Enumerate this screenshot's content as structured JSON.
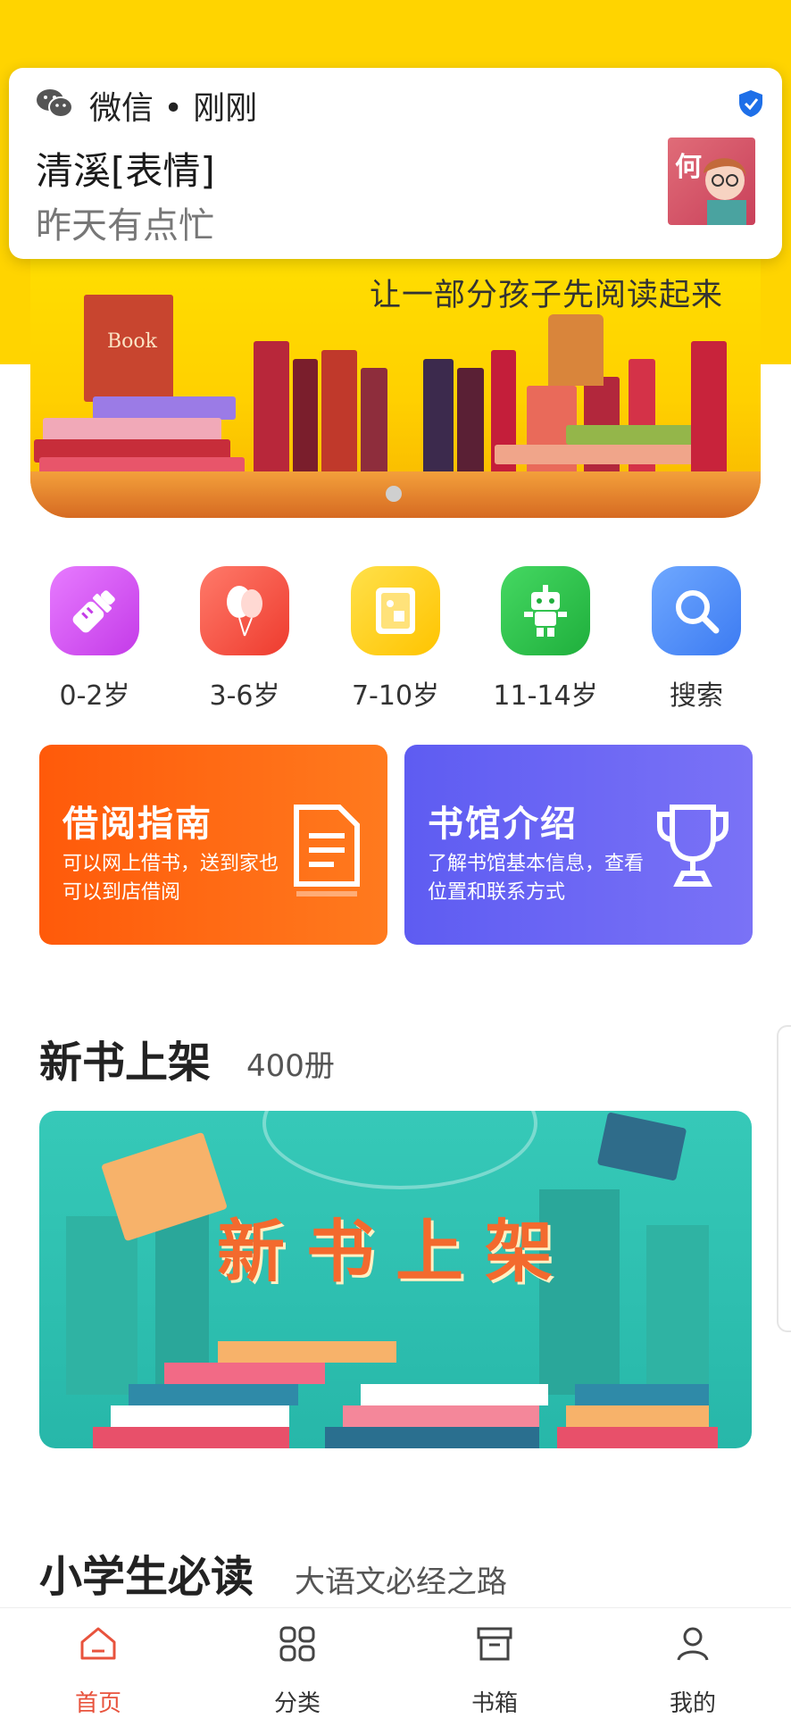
{
  "notification": {
    "app": "微信 • 刚刚",
    "title": "清溪[表情]",
    "body": "昨天有点忙",
    "avatar_char": "何"
  },
  "banner": {
    "slogan": "让一部分孩子先阅读起来",
    "book_label": "Book"
  },
  "categories": [
    {
      "label": "0-2岁",
      "color": "#D94FF2",
      "icon": "baby-bottle-icon"
    },
    {
      "label": "3-6岁",
      "color": "#F24A3C",
      "icon": "balloon-icon"
    },
    {
      "label": "7-10岁",
      "color": "#FFC800",
      "icon": "picture-book-icon"
    },
    {
      "label": "11-14岁",
      "color": "#2DC34A",
      "icon": "robot-icon"
    },
    {
      "label": "搜索",
      "color": "#4D8DF6",
      "icon": "search-icon"
    }
  ],
  "features": [
    {
      "title": "借阅指南",
      "desc": "可以网上借书，送到家也可以到店借阅",
      "icon": "document-icon"
    },
    {
      "title": "书馆介绍",
      "desc": "了解书馆基本信息，查看位置和联系方式",
      "icon": "trophy-icon"
    }
  ],
  "sections": {
    "new_books": {
      "title": "新书上架",
      "count": "400册",
      "banner_text": "新书上架"
    },
    "must_read": {
      "title": "小学生必读",
      "subtitle": "大语文必经之路"
    }
  },
  "nav": [
    {
      "label": "首页",
      "icon": "home-icon",
      "active": true
    },
    {
      "label": "分类",
      "icon": "grid-icon",
      "active": false
    },
    {
      "label": "书箱",
      "icon": "box-icon",
      "active": false
    },
    {
      "label": "我的",
      "icon": "profile-icon",
      "active": false
    }
  ],
  "colors": {
    "accent": "#E8533D",
    "brand_yellow": "#FFD400"
  }
}
